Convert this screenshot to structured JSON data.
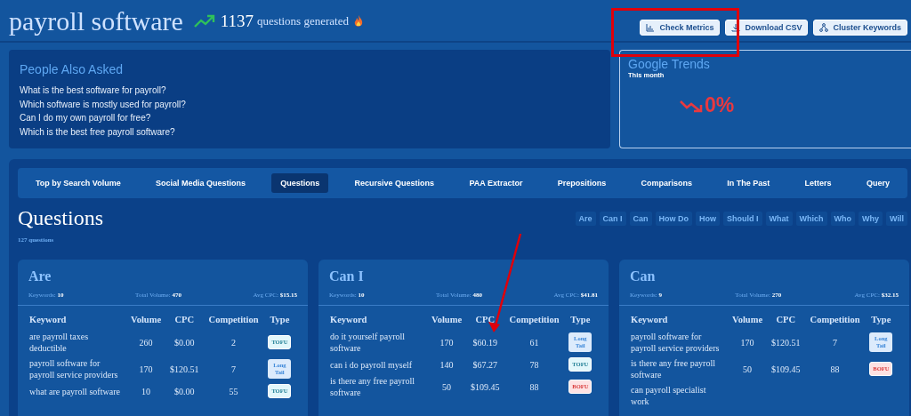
{
  "header": {
    "title": "payroll software",
    "count": "1137",
    "count_label": "questions generated",
    "buttons": [
      {
        "label": "Check Metrics"
      },
      {
        "label": "Download CSV"
      },
      {
        "label": "Cluster Keywords"
      }
    ]
  },
  "paa": {
    "title": "People Also Asked",
    "questions": [
      "What is the best software for payroll?",
      "Which software is mostly used for payroll?",
      "Can I do my own payroll for free?",
      "Which is the best free payroll software?"
    ]
  },
  "trends": {
    "title": "Google Trends",
    "period": "This month",
    "value": "0%"
  },
  "tabs": [
    {
      "label": "Top by Search Volume",
      "selected": false
    },
    {
      "label": "Social Media Questions",
      "selected": false
    },
    {
      "label": "Questions",
      "selected": true
    },
    {
      "label": "Recursive Questions",
      "selected": false
    },
    {
      "label": "PAA Extractor",
      "selected": false
    },
    {
      "label": "Prepositions",
      "selected": false
    },
    {
      "label": "Comparisons",
      "selected": false
    },
    {
      "label": "In The Past",
      "selected": false
    },
    {
      "label": "Letters",
      "selected": false
    },
    {
      "label": "Query",
      "selected": false
    }
  ],
  "section": {
    "title": "Questions",
    "count": "127 questions",
    "filters": [
      "Are",
      "Can I",
      "Can",
      "How Do",
      "How",
      "Should I",
      "What",
      "Which",
      "Who",
      "Why",
      "Will"
    ]
  },
  "cards": [
    {
      "title": "Are",
      "keywords_label": "Keywords:",
      "keywords": "10",
      "volume_label": "Total Volume:",
      "volume": "470",
      "cpc_label": "Avg CPC:",
      "cpc": "$15.15",
      "columns": [
        "Keyword",
        "Volume",
        "CPC",
        "Competition",
        "Type"
      ],
      "rows": [
        {
          "keyword": "are payroll taxes deductible",
          "volume": "260",
          "cpc": "$0.00",
          "competition": "2",
          "type": {
            "kind": "tofu",
            "label": "TOFU"
          }
        },
        {
          "keyword": "payroll software for payroll service providers",
          "volume": "170",
          "cpc": "$120.51",
          "competition": "7",
          "type": {
            "kind": "long_tail",
            "label": "Long Tail"
          }
        },
        {
          "keyword": "what are payroll software",
          "volume": "10",
          "cpc": "$0.00",
          "competition": "55",
          "type": {
            "kind": "tofu",
            "label": "TOFU"
          }
        }
      ]
    },
    {
      "title": "Can I",
      "keywords_label": "Keywords:",
      "keywords": "10",
      "volume_label": "Total Volume:",
      "volume": "480",
      "cpc_label": "Avg CPC:",
      "cpc": "$41.81",
      "columns": [
        "Keyword",
        "Volume",
        "CPC",
        "Competition",
        "Type"
      ],
      "rows": [
        {
          "keyword": "do it yourself payroll software",
          "volume": "170",
          "cpc": "$60.19",
          "competition": "61",
          "type": {
            "kind": "long_tail",
            "label": "Long Tail"
          }
        },
        {
          "keyword": "can i do payroll myself",
          "volume": "140",
          "cpc": "$67.27",
          "competition": "78",
          "type": {
            "kind": "tofu",
            "label": "TOFU"
          }
        },
        {
          "keyword": "is there any free payroll software",
          "volume": "50",
          "cpc": "$109.45",
          "competition": "88",
          "type": {
            "kind": "bofu",
            "label": "BOFU"
          }
        }
      ]
    },
    {
      "title": "Can",
      "keywords_label": "Keywords:",
      "keywords": "9",
      "volume_label": "Total Volume:",
      "volume": "270",
      "cpc_label": "Avg CPC:",
      "cpc": "$32.15",
      "columns": [
        "Keyword",
        "Volume",
        "CPC",
        "Competition",
        "Type"
      ],
      "rows": [
        {
          "keyword": "payroll software for payroll service providers",
          "volume": "170",
          "cpc": "$120.51",
          "competition": "7",
          "type": {
            "kind": "long_tail",
            "label": "Long Tail"
          }
        },
        {
          "keyword": "is there any free payroll software",
          "volume": "50",
          "cpc": "$109.45",
          "competition": "88",
          "type": {
            "kind": "bofu",
            "label": "BOFU"
          }
        },
        {
          "keyword": "can payroll specialist work"
        }
      ]
    }
  ]
}
